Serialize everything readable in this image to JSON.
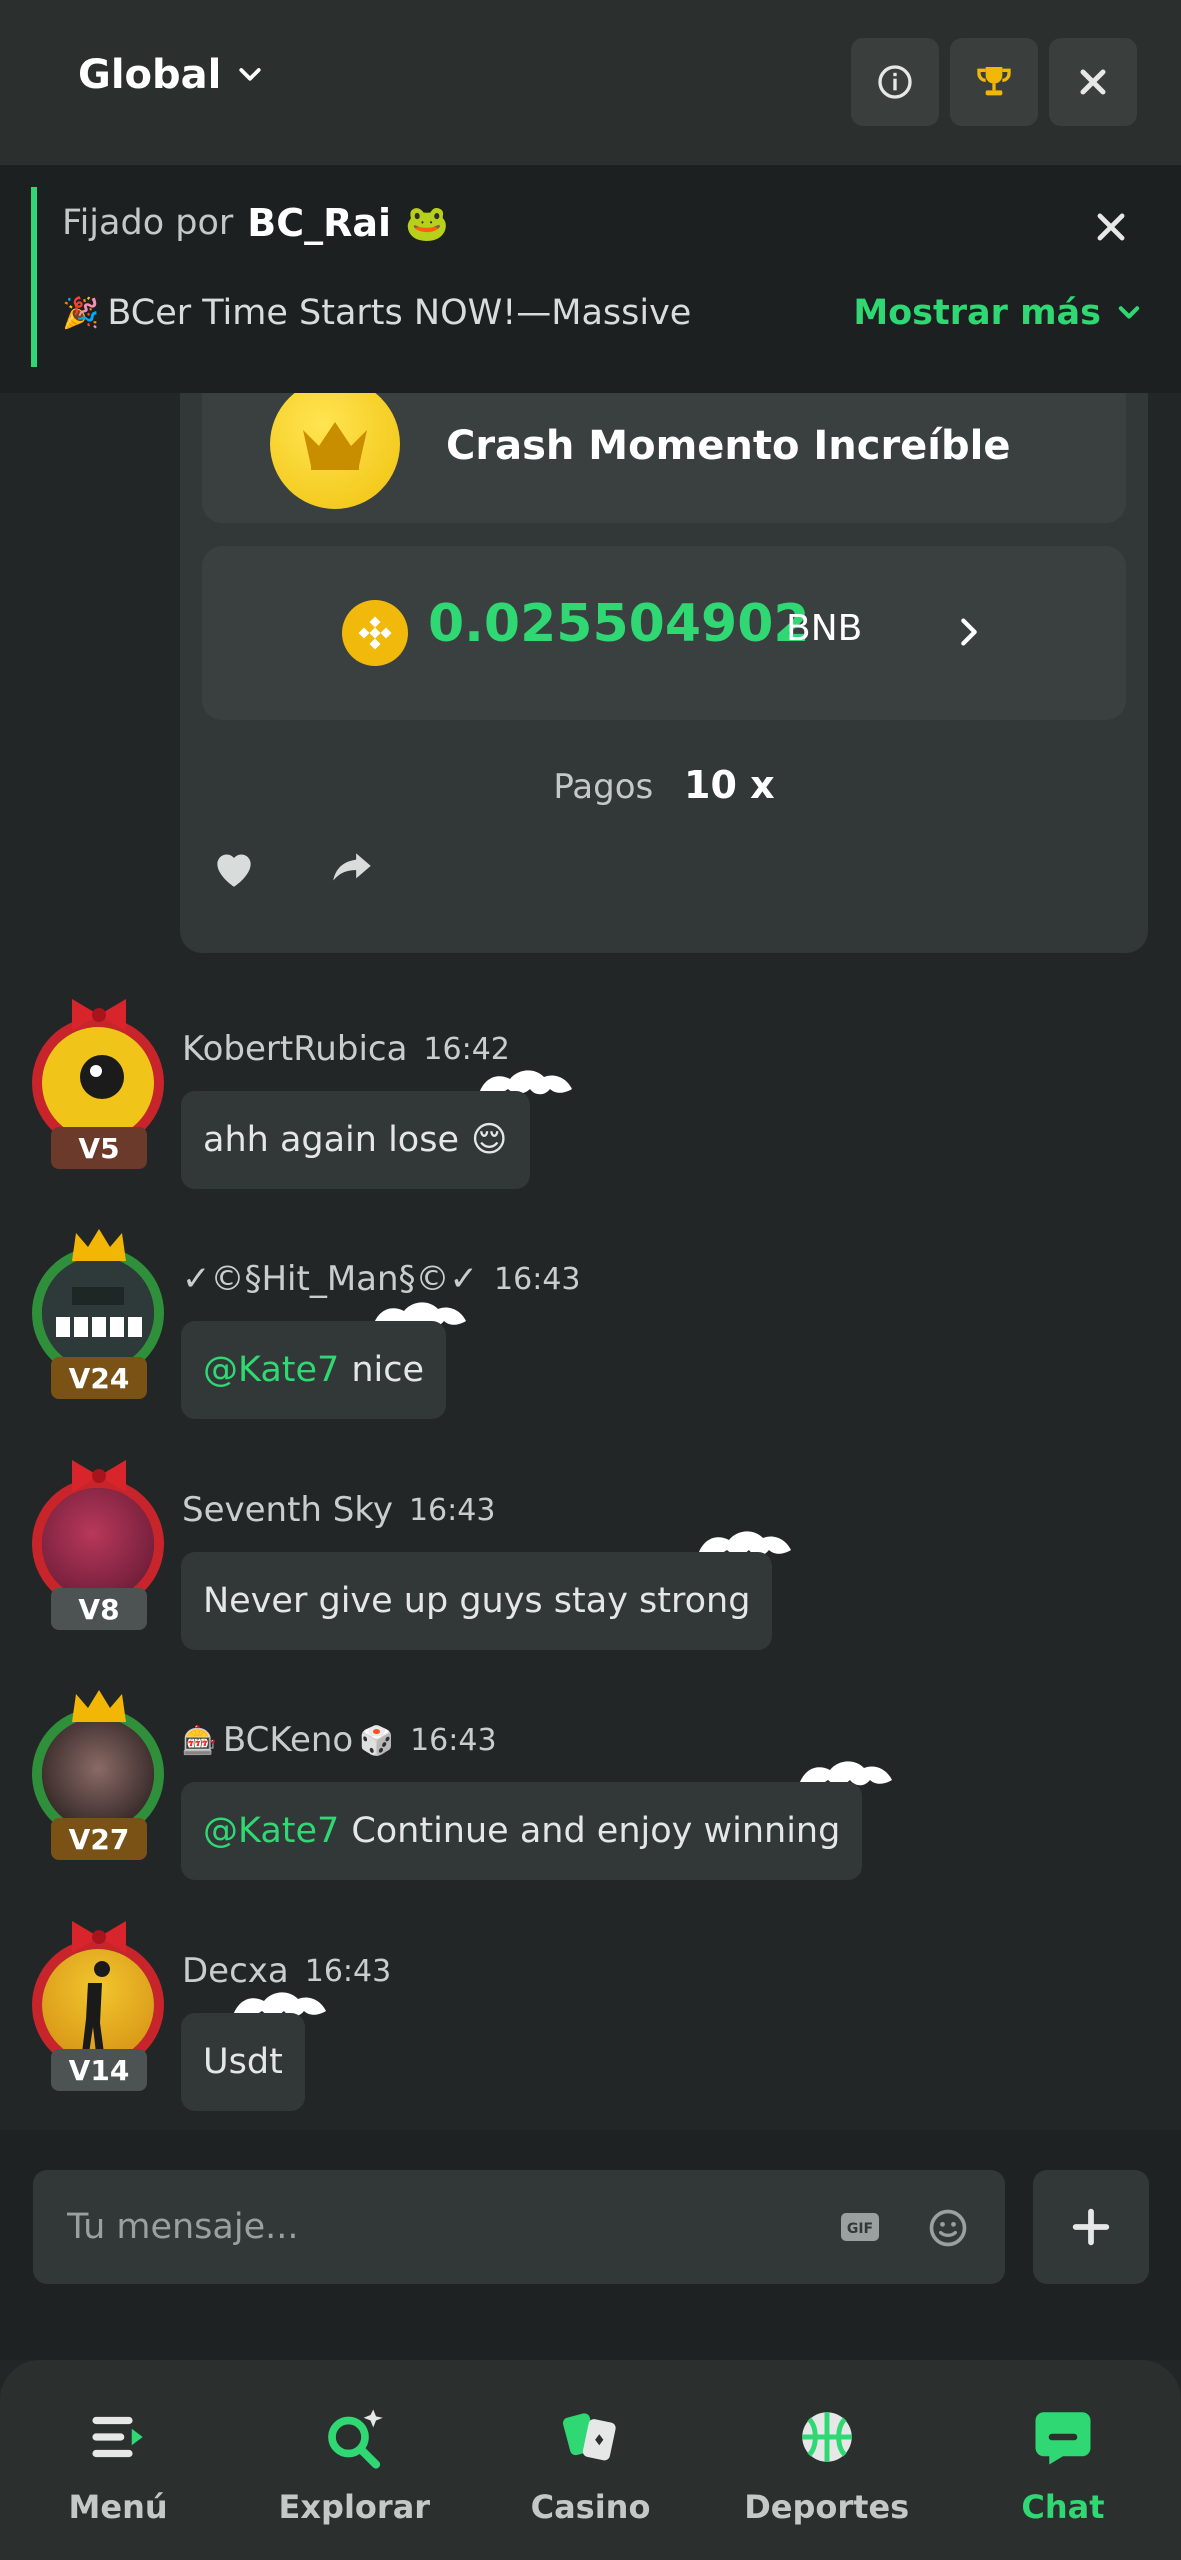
{
  "header": {
    "room": "Global",
    "buttons": [
      "info-icon",
      "trophy-icon",
      "close-icon"
    ]
  },
  "pinned": {
    "prefix": "Fijado por",
    "author": "BC_Rai",
    "author_emoji": "🐸",
    "text": "BCer Time Starts NOW!—Massive",
    "text_emoji": "🎉",
    "show_more": "Mostrar más"
  },
  "crash_card": {
    "title": "Crash Momento Increíble",
    "amount": "0.025504902",
    "currency": "BNB",
    "payout_label": "Pagos",
    "payout_value": "10 x"
  },
  "messages": [
    {
      "user": "KobertRubica",
      "time": "16:42",
      "level": "V5",
      "text": "ahh again lose",
      "emoji": "😌"
    },
    {
      "user": "✓©§Hit_Man§©✓",
      "time": "16:43",
      "level": "V24",
      "mention": "@Kate7",
      "text": "nice"
    },
    {
      "user": "Seventh Sky",
      "time": "16:43",
      "level": "V8",
      "text": "Never give up guys stay strong"
    },
    {
      "user": "BCKeno",
      "user_prefix_emoji": "🎰",
      "user_suffix_emoji": "🎲",
      "time": "16:43",
      "level": "V27",
      "mention": "@Kate7",
      "text": "Continue and enjoy winning"
    },
    {
      "user": "Decxa",
      "time": "16:43",
      "level": "V14",
      "text": "Usdt"
    }
  ],
  "composer": {
    "placeholder": "Tu mensaje..."
  },
  "nav": [
    {
      "label": "Menú",
      "icon": "menu-icon"
    },
    {
      "label": "Explorar",
      "icon": "search-sparkle-icon"
    },
    {
      "label": "Casino",
      "icon": "cards-icon"
    },
    {
      "label": "Deportes",
      "icon": "basketball-icon"
    },
    {
      "label": "Chat",
      "icon": "chat-icon",
      "active": true
    }
  ],
  "colors": {
    "accent": "#2fd873",
    "background": "#232626",
    "bubble": "#323737"
  }
}
